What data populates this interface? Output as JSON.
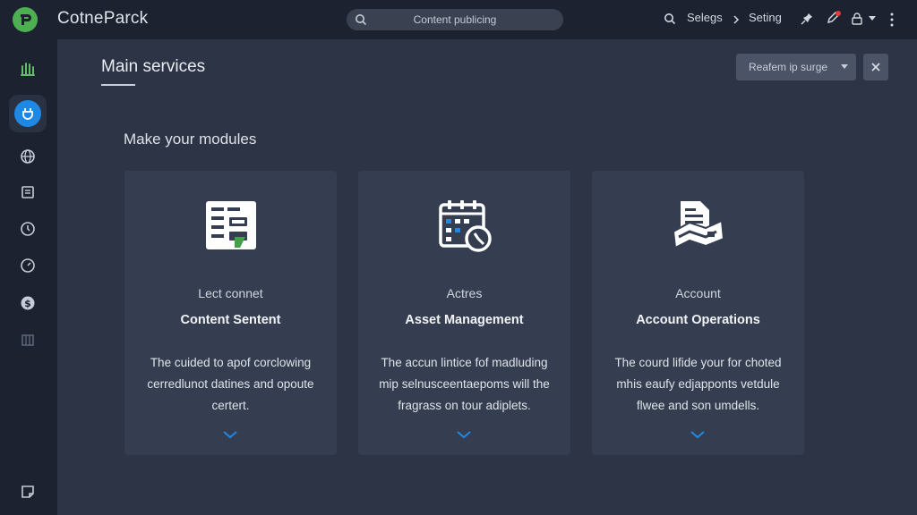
{
  "app": {
    "title": "CotneParck"
  },
  "search": {
    "text": "Content publicing"
  },
  "top_right": {
    "link1": "Selegs",
    "link2": "Seting"
  },
  "main": {
    "title": "Main services",
    "dropdown_label": "Reafem ip surge",
    "section_title": "Make your modules"
  },
  "cards": [
    {
      "overline": "Lect connet",
      "title": "Content Sentent",
      "desc_lines": [
        "The cuided to apof corclowing",
        "cerredlunot datines and opoute",
        "certert."
      ],
      "icon": "content-document-icon"
    },
    {
      "overline": "Actres",
      "title": "Asset Management",
      "desc_lines": [
        "The accun lintice fof madluding",
        "mip selnusceentaepoms will the",
        "fragrass on tour adiplets."
      ],
      "icon": "calendar-clock-icon"
    },
    {
      "overline": "Account",
      "title": "Account Operations",
      "desc_lines": [
        "The courd lifide your for choted",
        "mhis eaufy edjapponts vetdule",
        "flwee and son umdells."
      ],
      "icon": "document-map-icon"
    }
  ],
  "colors": {
    "accent": "#1e88e5",
    "logo": "#4caf50",
    "background": "#2c3445",
    "card": "#353e50"
  }
}
